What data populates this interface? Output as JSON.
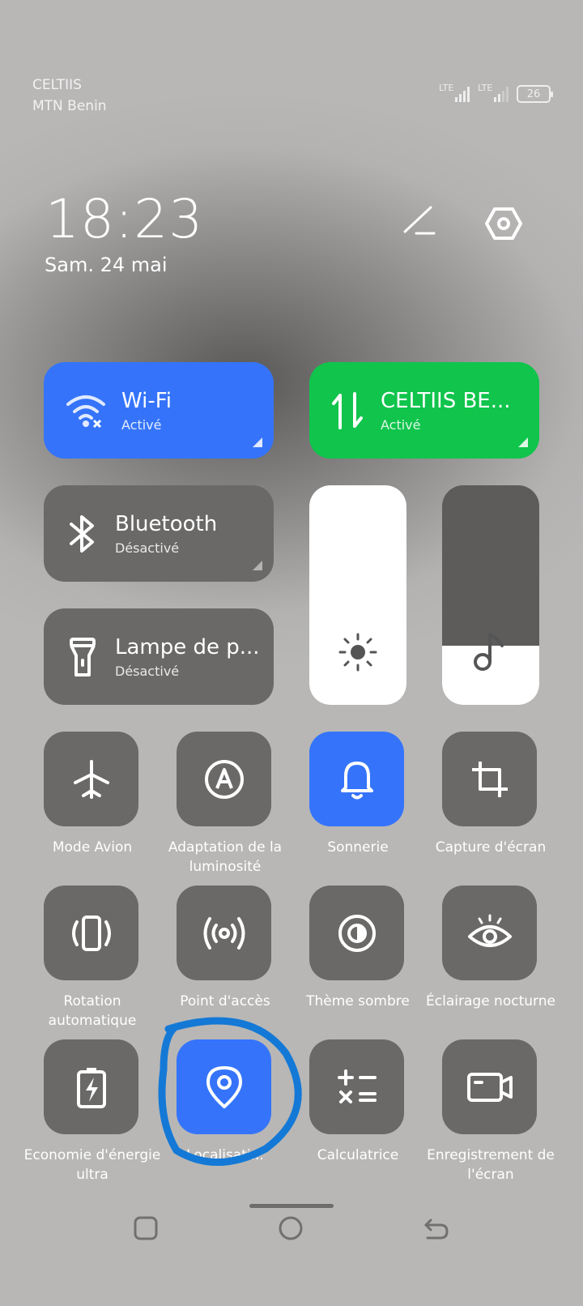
{
  "status_bar": {
    "carrier1": "CELTIIS",
    "carrier2": "MTN Benin",
    "signal1_label": "LTE",
    "signal2_label": "LTE",
    "battery": "26"
  },
  "header": {
    "time": "18:23",
    "date": "Sam. 24 mai",
    "edit_icon": "pencil-icon",
    "settings_icon": "gear-icon"
  },
  "tiles_wide": [
    {
      "title": "Wi-Fi",
      "status": "Activé",
      "color": "#3574fa"
    },
    {
      "title": "CELTIIS BE...",
      "status": "Activé",
      "color": "#10c44c"
    },
    {
      "title": "Bluetooth",
      "status": "Désactivé",
      "color": "#6a6968"
    },
    {
      "title": "Lampe de p...",
      "status": "Désactivé",
      "color": "#6a6968"
    }
  ],
  "sliders": {
    "brightness": {
      "icon": "sun-icon",
      "level": 1.0
    },
    "volume": {
      "icon": "music-note-icon",
      "level": 0.27
    }
  },
  "toggles": [
    {
      "label": "Mode Avion",
      "active": false
    },
    {
      "label": "Adaptation de la luminosité",
      "active": false
    },
    {
      "label": "Sonnerie",
      "active": true
    },
    {
      "label": "Capture d'écran",
      "active": false
    },
    {
      "label": "Rotation automatique",
      "active": false
    },
    {
      "label": "Point d'accès",
      "active": false
    },
    {
      "label": "Thème sombre",
      "active": false
    },
    {
      "label": "Éclairage nocturne",
      "active": false
    },
    {
      "label": "Economie d'énergie ultra",
      "active": false
    },
    {
      "label": "Localisati...",
      "active": true
    },
    {
      "label": "Calculatrice",
      "active": false
    },
    {
      "label": "Enregistrement de l'écran",
      "active": false
    }
  ],
  "annotation_color": "#1479d6",
  "nav": {
    "recents": "square-icon",
    "home": "circle-icon",
    "back": "back-arrow-icon"
  }
}
